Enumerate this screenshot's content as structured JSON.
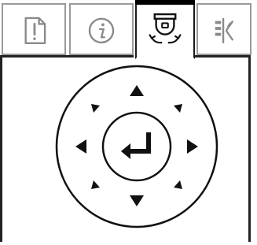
{
  "tabs": [
    {
      "name": "alert",
      "icon": "alert-document-icon",
      "active": false
    },
    {
      "name": "info",
      "icon": "info-icon",
      "active": false
    },
    {
      "name": "camera-control",
      "icon": "ptz-camera-icon",
      "active": true
    },
    {
      "name": "io",
      "icon": "input-output-icon",
      "active": false
    }
  ],
  "ptz": {
    "center_icon": "enter-return-icon",
    "directions": [
      "up",
      "up-right",
      "right",
      "down-right",
      "down",
      "down-left",
      "left",
      "up-left"
    ]
  },
  "colors": {
    "icon_gray": "#8a8a8a",
    "ink": "#111111",
    "border_gray": "#9a9a9a"
  }
}
